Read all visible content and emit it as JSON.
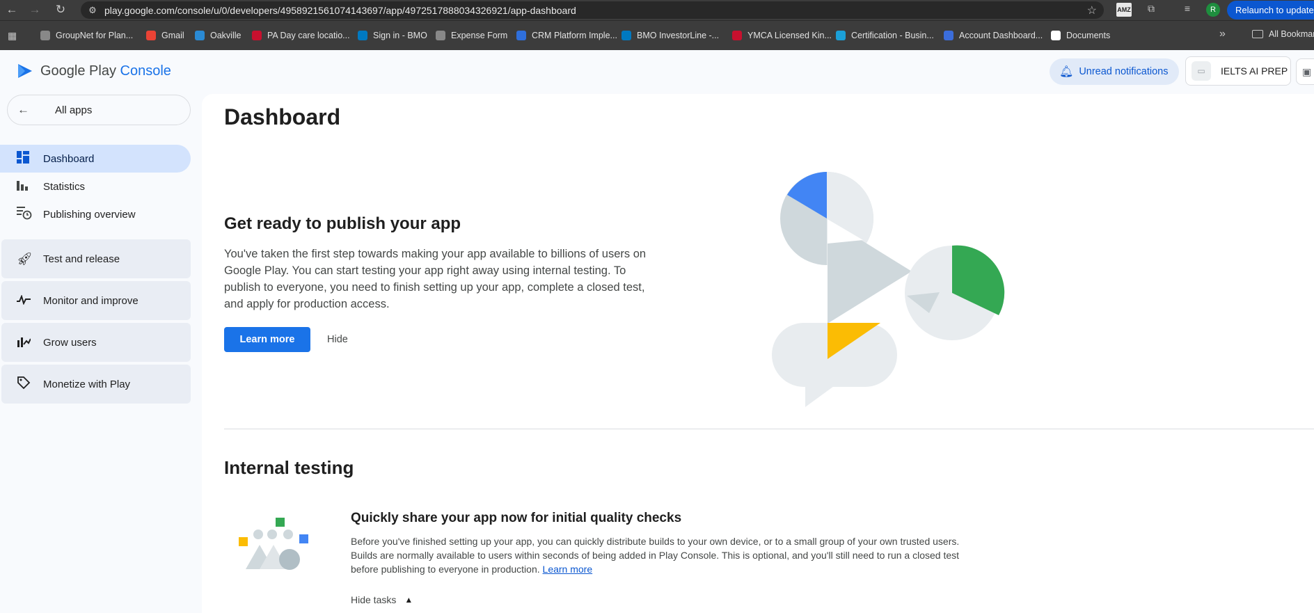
{
  "browser": {
    "url": "play.google.com/console/u/0/developers/4958921561074143697/app/4972517888034326921/app-dashboard",
    "profile_initial": "R",
    "relaunch_label": "Relaunch to update",
    "amz_label": "AMZ",
    "bookmarks": [
      {
        "label": "GroupNet for Plan...",
        "color": "#888888"
      },
      {
        "label": "Gmail",
        "color": "#ea4335"
      },
      {
        "label": "Oakville",
        "color": "#2a8ad4"
      },
      {
        "label": "PA Day care locatio...",
        "color": "#c8102e"
      },
      {
        "label": "Sign in - BMO",
        "color": "#0079c1"
      },
      {
        "label": "Expense Form",
        "color": "#888888"
      },
      {
        "label": "CRM Platform Imple...",
        "color": "#2f6fdb"
      },
      {
        "label": "BMO InvestorLine -...",
        "color": "#0079c1"
      },
      {
        "label": "YMCA Licensed Kin...",
        "color": "#c8102e"
      },
      {
        "label": "Certification - Busin...",
        "color": "#1ba0d8"
      },
      {
        "label": "Account Dashboard...",
        "color": "#3b6ddb"
      },
      {
        "label": "Documents",
        "color": "#ffffff"
      }
    ],
    "all_bookmarks_label": "All Bookmarks"
  },
  "header": {
    "logo_main": "Google Play ",
    "logo_accent": "Console",
    "notifications_label": "Unread notifications",
    "app_name": "IELTS AI PREP"
  },
  "sidebar": {
    "all_apps_label": "All apps",
    "items": [
      {
        "label": "Dashboard",
        "icon": "dashboard-icon"
      },
      {
        "label": "Statistics",
        "icon": "bar-chart-icon"
      },
      {
        "label": "Publishing overview",
        "icon": "schedule-list-icon"
      }
    ],
    "sections": [
      {
        "label": "Test and release",
        "icon": "rocket-icon"
      },
      {
        "label": "Monitor and improve",
        "icon": "vitals-icon"
      },
      {
        "label": "Grow users",
        "icon": "growth-icon"
      },
      {
        "label": "Monetize with Play",
        "icon": "tag-icon"
      }
    ]
  },
  "main": {
    "title": "Dashboard",
    "publish_card": {
      "title": "Get ready to publish your app",
      "description": "You've taken the first step towards making your app available to billions of users on Google Play. You can start testing your app right away using internal testing. To publish to everyone, you need to finish setting up your app, complete a closed test, and apply for production access.",
      "learn_more_label": "Learn more",
      "hide_label": "Hide"
    },
    "internal_testing": {
      "title": "Internal testing",
      "subtitle": "Quickly share your app now for initial quality checks",
      "description": "Before you've finished setting up your app, you can quickly distribute builds to your own device, or to a small group of your own trusted users. Builds are normally available to users within seconds of being added in Play Console. This is optional, and you'll still need to run a closed test before publishing to everyone in production.",
      "learn_more_label": "Learn more",
      "hide_tasks_label": "Hide tasks"
    }
  },
  "colors": {
    "accent": "#1a73e8",
    "active_nav": "#d3e3fd",
    "illus_blue": "#4285f4",
    "illus_green": "#34a853",
    "illus_yellow": "#fbbc04",
    "illus_grey": "#cfd8dc"
  }
}
